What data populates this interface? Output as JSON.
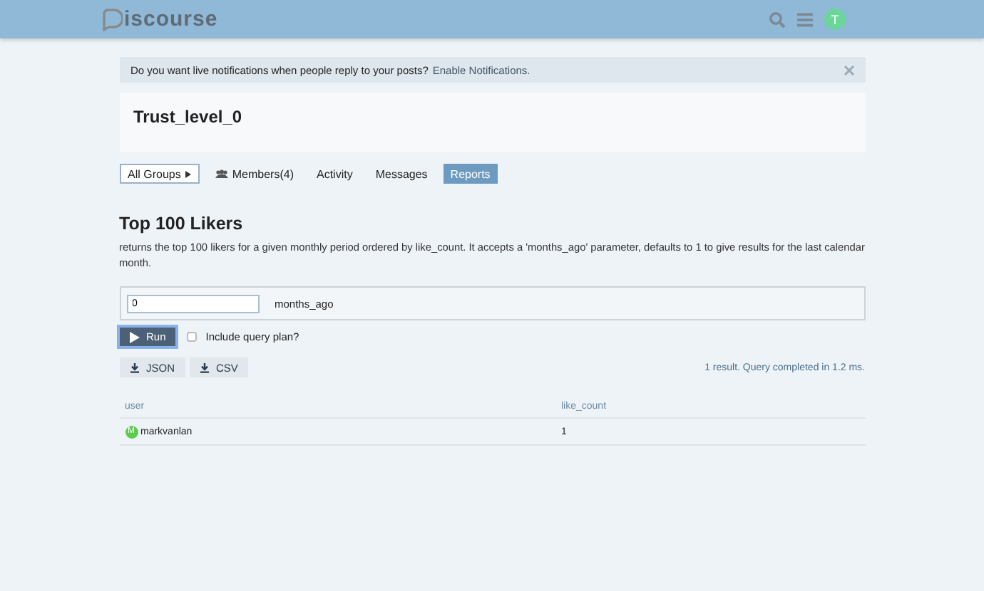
{
  "header": {
    "logo_text": "iscourse",
    "avatar_letter": "T"
  },
  "notice": {
    "text": "Do you want live notifications when people reply to your posts?",
    "link": "Enable Notifications."
  },
  "group": {
    "title": "Trust_level_0"
  },
  "nav": [
    {
      "label": "All Groups",
      "kind": "dropdown",
      "selected": false
    },
    {
      "label": "Members(4)",
      "kind": "members",
      "selected": false
    },
    {
      "label": "Activity",
      "kind": "tab",
      "selected": false
    },
    {
      "label": "Messages",
      "kind": "tab",
      "selected": false
    },
    {
      "label": "Reports",
      "kind": "tab",
      "selected": true
    }
  ],
  "report": {
    "title": "Top 100 Likers",
    "description": "returns the top 100 likers for a given monthly period ordered by like_count. It accepts a 'months_ago' parameter, defaults to 1 to give results for the last calendar month.",
    "param": {
      "value": "0",
      "label": "months_ago"
    },
    "run_label": "Run",
    "query_plan": {
      "label": "Include query plan?",
      "checked": false
    },
    "downloads": [
      "JSON",
      "CSV"
    ],
    "result_summary": "1 result. Query completed in 1.2 ms."
  },
  "table": {
    "columns": [
      "user",
      "like_count"
    ],
    "rows": [
      {
        "avatar_letter": "M",
        "user": "markvanlan",
        "like_count": "1"
      }
    ]
  }
}
